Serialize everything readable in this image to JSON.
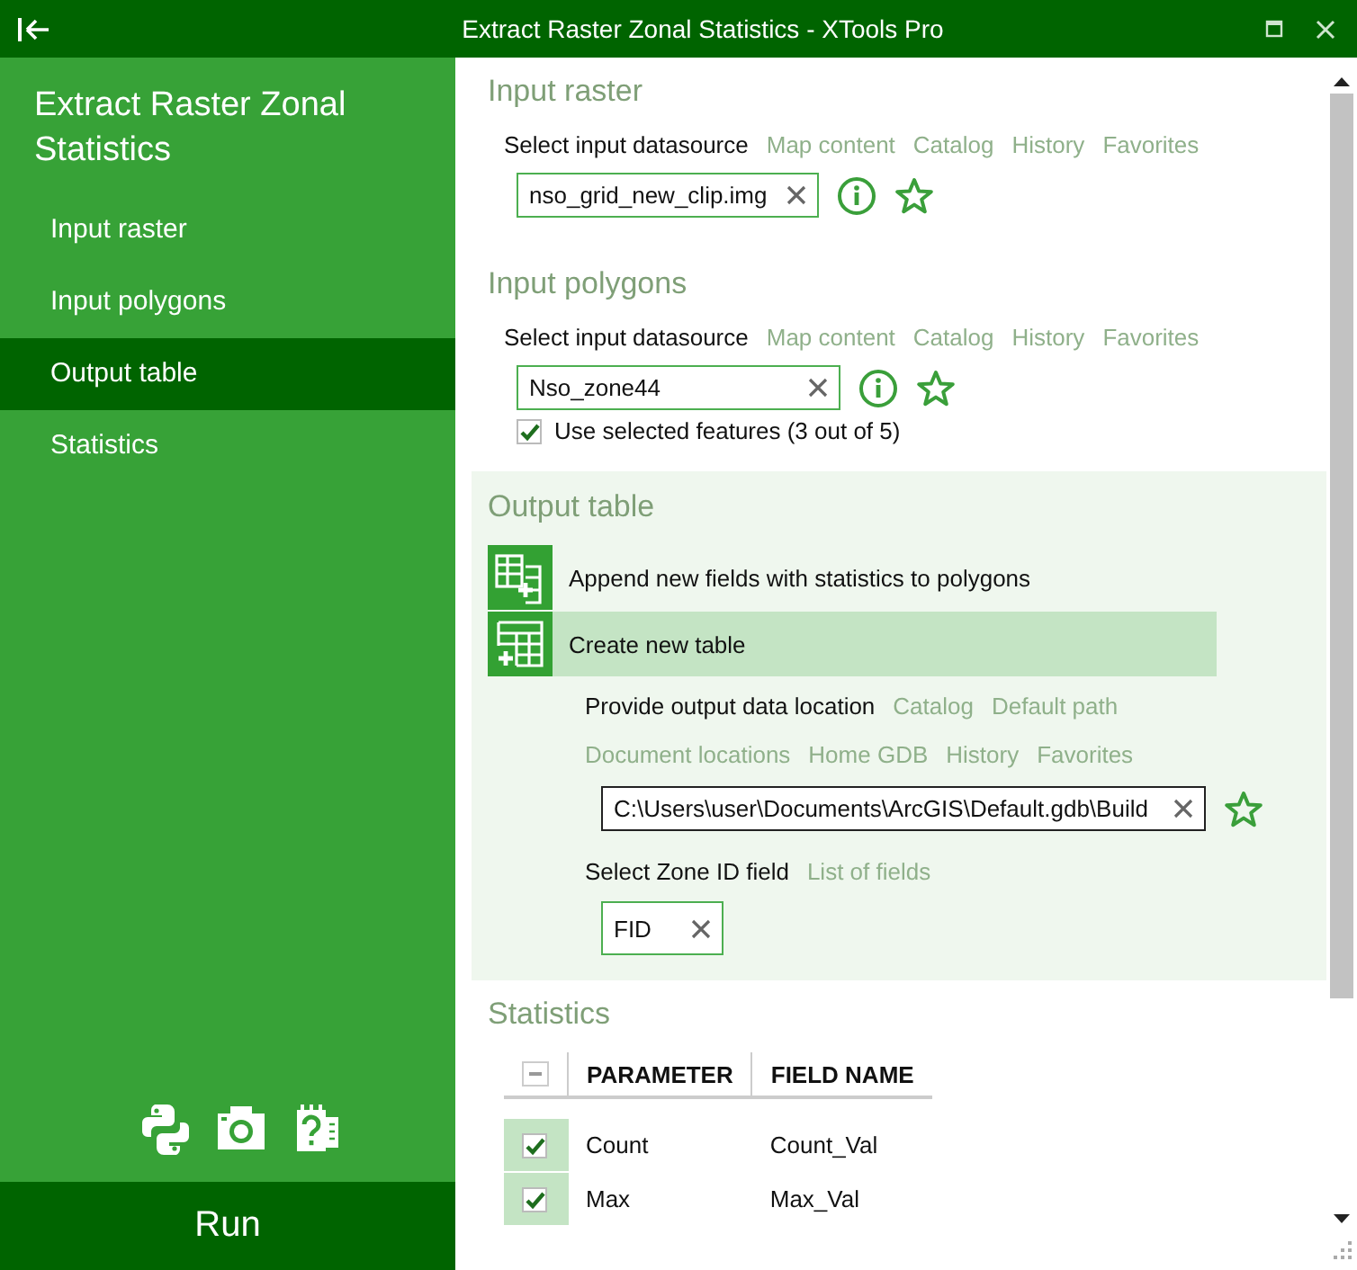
{
  "window": {
    "title": "Extract Raster Zonal Statistics - XTools Pro"
  },
  "sidebar": {
    "title": "Extract Raster Zonal Statistics",
    "items": [
      {
        "label": "Input raster",
        "selected": false
      },
      {
        "label": "Input polygons",
        "selected": false
      },
      {
        "label": "Output table",
        "selected": true
      },
      {
        "label": "Statistics",
        "selected": false
      }
    ],
    "run_button": "Run"
  },
  "input_raster": {
    "title": "Input raster",
    "prompt": "Select input datasource",
    "links": [
      "Map content",
      "Catalog",
      "History",
      "Favorites"
    ],
    "value": "nso_grid_new_clip.img"
  },
  "input_polygons": {
    "title": "Input polygons",
    "prompt": "Select input datasource",
    "links": [
      "Map content",
      "Catalog",
      "History",
      "Favorites"
    ],
    "value": "Nso_zone44",
    "checkbox": {
      "label": "Use selected features (3 out of 5)",
      "checked": true
    }
  },
  "output_table": {
    "title": "Output table",
    "options": [
      {
        "label": "Append new fields with statistics to polygons",
        "kind": "append",
        "selected": false
      },
      {
        "label": "Create new table",
        "kind": "create",
        "selected": true
      }
    ],
    "location": {
      "prompt": "Provide output data location",
      "links": [
        "Catalog",
        "Default path",
        "Document locations",
        "Home GDB",
        "History",
        "Favorites"
      ],
      "value": "C:\\Users\\user\\Documents\\ArcGIS\\Default.gdb\\Build"
    },
    "zone": {
      "prompt": "Select Zone ID field",
      "links": [
        "List of fields"
      ],
      "value": "FID"
    }
  },
  "statistics": {
    "title": "Statistics",
    "select_all": {
      "indeterminate": true
    },
    "columns": [
      "PARAMETER",
      "FIELD NAME"
    ],
    "rows": [
      {
        "parameter": "Count",
        "field_name": "Count_Val",
        "checked": true
      },
      {
        "parameter": "Max",
        "field_name": "Max_Val",
        "checked": true
      }
    ]
  }
}
